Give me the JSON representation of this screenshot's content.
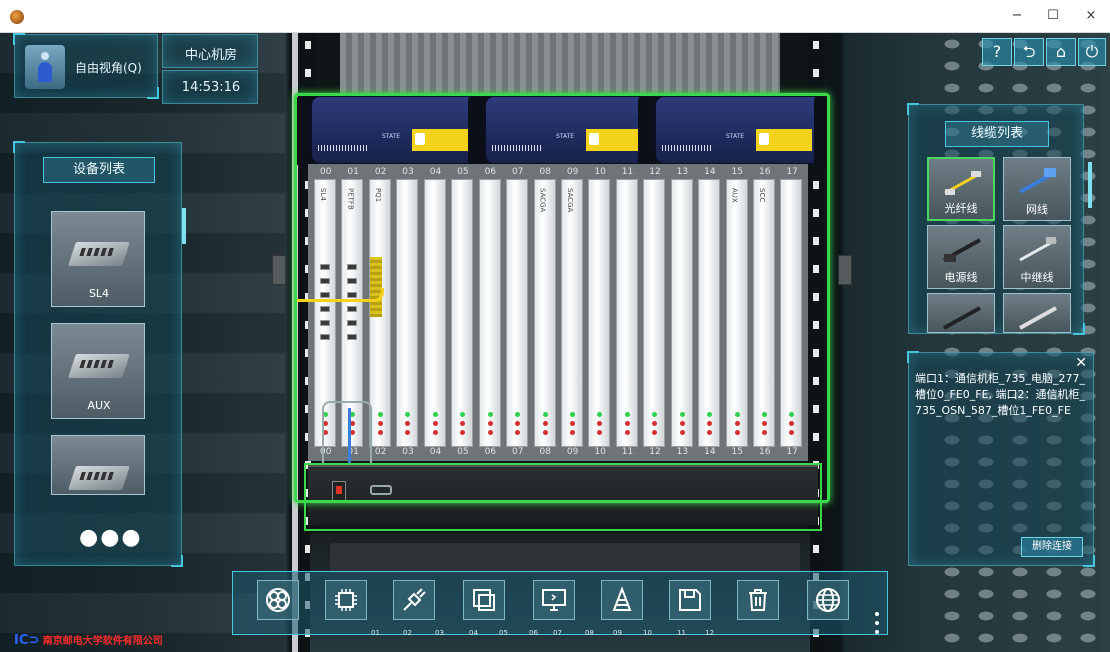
{
  "window": {
    "minimize": "−",
    "maximize": "☐",
    "close": "×"
  },
  "hud": {
    "view_mode": "自由视角(Q)",
    "room": "中心机房",
    "time": "14:53:16"
  },
  "device_list": {
    "title": "设备列表",
    "items": [
      {
        "label": "SL4"
      },
      {
        "label": "AUX"
      },
      {
        "label": ""
      }
    ],
    "more": "●●●"
  },
  "cable_list": {
    "title": "线缆列表",
    "items": [
      {
        "label": "光纤线",
        "active": true
      },
      {
        "label": "网线",
        "active": false
      },
      {
        "label": "电源线",
        "active": false
      },
      {
        "label": "中继线",
        "active": false
      },
      {
        "label": "",
        "active": false
      },
      {
        "label": "",
        "active": false
      }
    ]
  },
  "top_right_icons": [
    "help-icon",
    "return-icon",
    "home-icon",
    "power-icon"
  ],
  "top_right_glyphs": [
    "?",
    "⮌",
    "⌂",
    "⏻"
  ],
  "connection_info": {
    "text": "端口1：通信机柜_735_电脑_277_槽位0_FE0_FE, 端口2：通信机柜_735_OSN_587_槽位1_FE0_FE",
    "close": "✕",
    "delete_label": "删除连接"
  },
  "rack": {
    "slot_numbers": [
      "00",
      "01",
      "02",
      "03",
      "04",
      "05",
      "06",
      "07",
      "08",
      "09",
      "10",
      "11",
      "12",
      "13",
      "14",
      "15",
      "16",
      "17"
    ],
    "board_labels": [
      "SL4",
      "PETFB",
      "PQ1",
      "",
      "",
      "",
      "",
      "",
      "SACGA",
      "SACGA",
      "",
      "",
      "",
      "",
      "",
      "AUX",
      "SCC",
      ""
    ],
    "psu_state_label": "STATE"
  },
  "toolbar": {
    "buttons": [
      "network-tool-icon",
      "chip-icon",
      "plug-icon",
      "layers-icon",
      "monitor-icon",
      "cone-icon",
      "save-icon",
      "trash-icon",
      "globe-icon"
    ],
    "numbers": [
      "01",
      "02",
      "03",
      "04",
      "05",
      "06",
      "07",
      "08",
      "09",
      "10",
      "11",
      "12"
    ]
  },
  "logo": {
    "text": "南京邮电大学软件有限公司"
  }
}
